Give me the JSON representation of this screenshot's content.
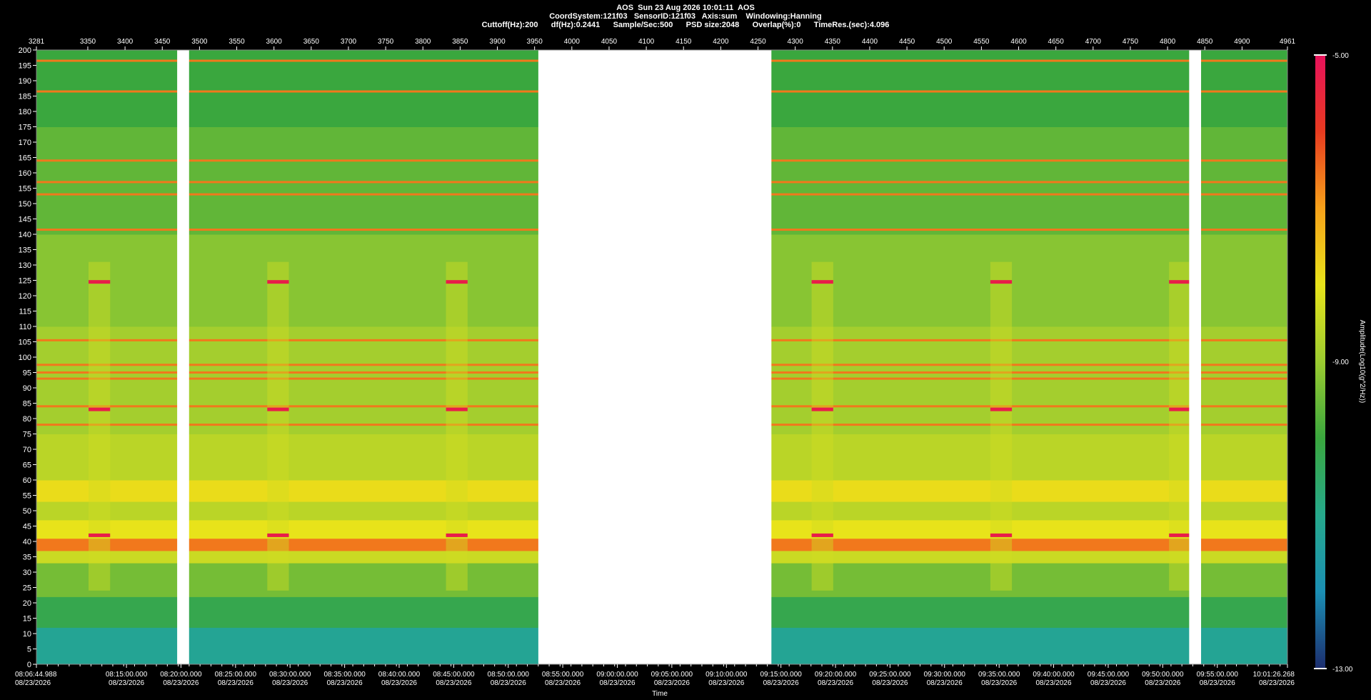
{
  "header": {
    "line1": "AOS  Sun 23 Aug 2026 10:01:11  AOS",
    "line2": "CoordSystem:121f03   SensorID:121f03   Axis:sum    Windowing:Hanning",
    "line3": "Cuttoff(Hz):200      df(Hz):0.2441      Sample/Sec:500      PSD size:2048      Overlap(%):0      TimeRes.(sec):4.096"
  },
  "chart_data": {
    "type": "heatmap",
    "title": "AOS  Sun 23 Aug 2026 10:01:11  AOS",
    "xlabel": "Time",
    "ylabel": "",
    "ylim": [
      0,
      200
    ],
    "y_ticks": [
      0,
      5,
      10,
      15,
      20,
      25,
      30,
      35,
      40,
      45,
      50,
      55,
      60,
      65,
      70,
      75,
      80,
      85,
      90,
      95,
      100,
      105,
      110,
      115,
      120,
      125,
      130,
      135,
      140,
      145,
      150,
      155,
      160,
      165,
      170,
      175,
      180,
      185,
      190,
      195,
      200
    ],
    "top_axis_range": [
      3281,
      4961
    ],
    "top_ticks": [
      3281,
      3350,
      3400,
      3450,
      3500,
      3550,
      3600,
      3650,
      3700,
      3750,
      3800,
      3850,
      3900,
      3950,
      4000,
      4050,
      4100,
      4150,
      4200,
      4250,
      4300,
      4350,
      4400,
      4450,
      4500,
      4550,
      4600,
      4650,
      4700,
      4750,
      4800,
      4850,
      4900,
      4961
    ],
    "bottom_ticks": [
      {
        "time": "08:06:44.988",
        "date": "08/23/2026",
        "t": 3281
      },
      {
        "time": "08:15:00.000",
        "date": "08/23/2026",
        "t": 3401.9
      },
      {
        "time": "08:20:00.000",
        "date": "08/23/2026",
        "t": 3475.1
      },
      {
        "time": "08:25:00.000",
        "date": "08/23/2026",
        "t": 3548.4
      },
      {
        "time": "08:30:00.000",
        "date": "08/23/2026",
        "t": 3621.6
      },
      {
        "time": "08:35:00.000",
        "date": "08/23/2026",
        "t": 3694.9
      },
      {
        "time": "08:40:00.000",
        "date": "08/23/2026",
        "t": 3768.1
      },
      {
        "time": "08:45:00.000",
        "date": "08/23/2026",
        "t": 3841.4
      },
      {
        "time": "08:50:00.000",
        "date": "08/23/2026",
        "t": 3914.6
      },
      {
        "time": "08:55:00.000",
        "date": "08/23/2026",
        "t": 3987.8
      },
      {
        "time": "09:00:00.000",
        "date": "08/23/2026",
        "t": 4061.1
      },
      {
        "time": "09:05:00.000",
        "date": "08/23/2026",
        "t": 4134.3
      },
      {
        "time": "09:10:00.000",
        "date": "08/23/2026",
        "t": 4207.6
      },
      {
        "time": "09:15:00.000",
        "date": "08/23/2026",
        "t": 4280.8
      },
      {
        "time": "09:20:00.000",
        "date": "08/23/2026",
        "t": 4354.1
      },
      {
        "time": "09:25:00.000",
        "date": "08/23/2026",
        "t": 4427.3
      },
      {
        "time": "09:30:00.000",
        "date": "08/23/2026",
        "t": 4500.5
      },
      {
        "time": "09:35:00.000",
        "date": "08/23/2026",
        "t": 4573.8
      },
      {
        "time": "09:40:00.000",
        "date": "08/23/2026",
        "t": 4647.0
      },
      {
        "time": "09:45:00.000",
        "date": "08/23/2026",
        "t": 4720.3
      },
      {
        "time": "09:50:00.000",
        "date": "08/23/2026",
        "t": 4793.5
      },
      {
        "time": "09:55:00.000",
        "date": "08/23/2026",
        "t": 4866.8
      },
      {
        "time": "10:01:26.268",
        "date": "08/23/2026",
        "t": 4961
      }
    ],
    "gaps": [
      [
        3470,
        3486
      ],
      [
        3955,
        4268
      ],
      [
        4829,
        4845
      ]
    ],
    "band_levels": [
      {
        "from": 0,
        "to": 12,
        "level": -11.2
      },
      {
        "from": 12,
        "to": 22,
        "level": -10.2
      },
      {
        "from": 22,
        "to": 33,
        "level": -9.4
      },
      {
        "from": 33,
        "to": 37,
        "level": -8.4
      },
      {
        "from": 37,
        "to": 41,
        "level": -6.6
      },
      {
        "from": 41,
        "to": 47,
        "level": -8.0
      },
      {
        "from": 47,
        "to": 53,
        "level": -8.6
      },
      {
        "from": 53,
        "to": 60,
        "level": -7.9
      },
      {
        "from": 60,
        "to": 75,
        "level": -8.6
      },
      {
        "from": 75,
        "to": 110,
        "level": -8.9
      },
      {
        "from": 110,
        "to": 140,
        "level": -9.2
      },
      {
        "from": 140,
        "to": 175,
        "level": -9.6
      },
      {
        "from": 175,
        "to": 200,
        "level": -10.0
      }
    ],
    "tones_hz": [
      196.5,
      186.5,
      164,
      157,
      153,
      141.5,
      105.5,
      97.5,
      95,
      93,
      84,
      78
    ],
    "events": [
      [
        3351,
        3380
      ],
      [
        3591,
        3620
      ],
      [
        3831,
        3860
      ],
      [
        4322,
        4351
      ],
      [
        4562,
        4591
      ],
      [
        4802,
        4831
      ]
    ],
    "event_tones_hz": [
      124.5,
      83,
      42
    ],
    "colorbar": {
      "label": "Amplitude(Log10(g^2/Hz))",
      "min": -13.0,
      "max": -5.0,
      "ticks": [
        "-5.00",
        "-9.00",
        "-13.00"
      ],
      "colors": [
        "#1c2d6e",
        "#1b8fb4",
        "#26a98c",
        "#3aa73e",
        "#9ccc30",
        "#e8e31a",
        "#f7a11a",
        "#e83a20",
        "#e8115c"
      ]
    }
  }
}
